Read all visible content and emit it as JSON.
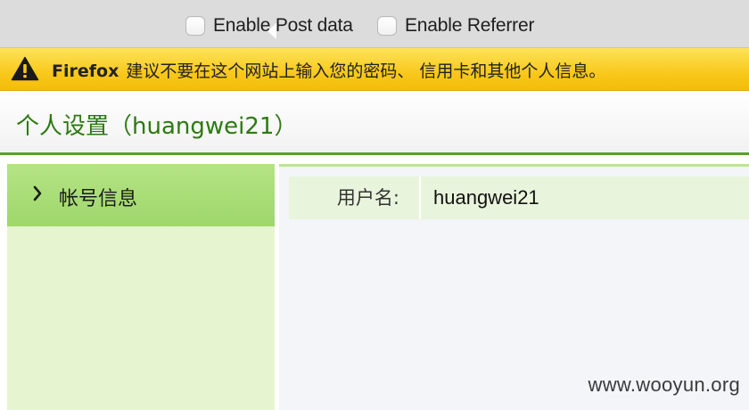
{
  "toolbar": {
    "enable_post_label": "Enable Post data",
    "enable_referrer_label": "Enable Referrer"
  },
  "warning": {
    "brand": "Firefox",
    "message": "建议不要在这个网站上输入您的密码、 信用卡和其他个人信息。",
    "icon": "warning-triangle-icon"
  },
  "page": {
    "title": "个人设置（huangwei21）"
  },
  "sidebar": {
    "items": [
      {
        "label": "帐号信息",
        "icon": "chevron-right-icon",
        "active": true
      }
    ]
  },
  "account": {
    "fields": [
      {
        "label": "用户名:",
        "value": "huangwei21"
      }
    ]
  },
  "watermark": "www.wooyun.org",
  "colors": {
    "title_green": "#2c7a10",
    "header_rule_green": "#56a02c",
    "warning_yellow": "#f9c81b",
    "nav_active_green": "#9fd76a",
    "sidebar_bg": "#e6f5cf"
  }
}
